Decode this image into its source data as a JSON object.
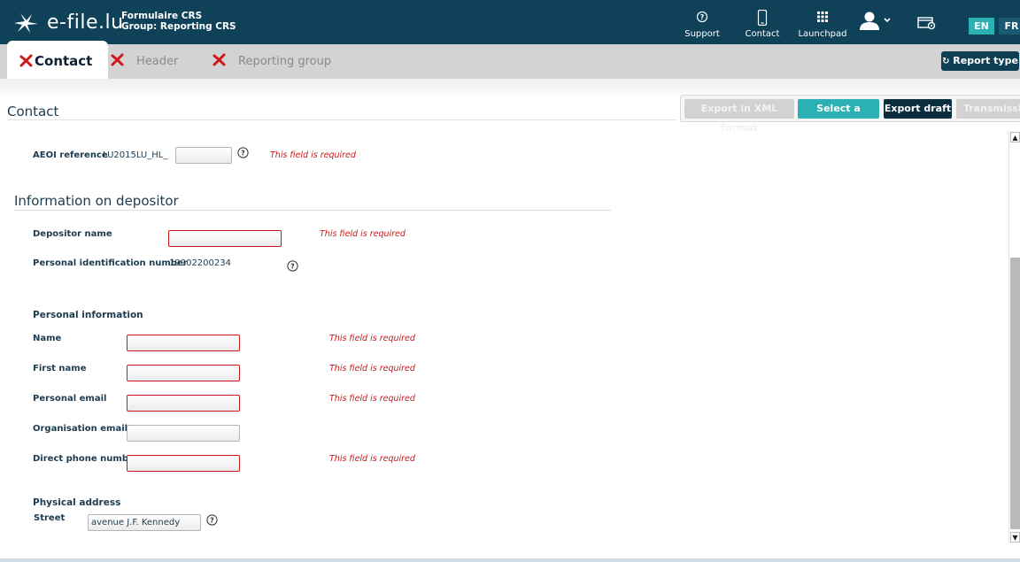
{
  "header": {
    "logo_text": "e-file.lu",
    "app_title": "Formulaire CRS",
    "group_label": "Group: Reporting CRS",
    "nav": {
      "support": "Support",
      "contact": "Contact",
      "launchpad": "Launchpad"
    },
    "languages": [
      "EN",
      "FR"
    ]
  },
  "tabs": [
    {
      "label": "Contact",
      "active": true
    },
    {
      "label": "Header",
      "active": false
    },
    {
      "label": "Reporting group",
      "active": false
    }
  ],
  "report_type_label": "Report type",
  "page_title": "Contact",
  "actions": {
    "export_xml": "Export in XML format",
    "select_report": "Select a report",
    "export_draft": "Export draft",
    "transmission": "Transmission"
  },
  "error_text": "This field is required",
  "aeoi": {
    "label": "AEOI reference",
    "prefix": "LU2015LU_HL_",
    "value": ""
  },
  "depositor": {
    "title": "Information on depositor",
    "name_label": "Depositor name",
    "pin_label": "Personal identification number",
    "pin_value": "19902200234"
  },
  "personal": {
    "title": "Personal information",
    "name_label": "Name",
    "first_name_label": "First name",
    "personal_email_label": "Personal email",
    "org_email_label": "Organisation email",
    "phone_label": "Direct phone number"
  },
  "address": {
    "title": "Physical address",
    "street_label": "Street",
    "street_value": "avenue J.F. Kennedy"
  },
  "colors": {
    "topbar": "#0f4159",
    "accent_teal": "#2bb1b4",
    "error": "#c81a1a",
    "lang_active": "#2bb1b4"
  }
}
